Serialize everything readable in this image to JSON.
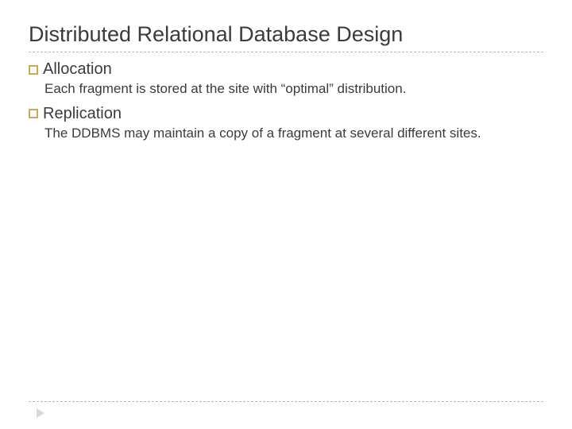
{
  "title": "Distributed Relational Database Design",
  "items": [
    {
      "heading": "Allocation",
      "body": "Each fragment is stored at the site with “optimal” distribution."
    },
    {
      "heading": "Replication",
      "body": "The DDBMS may maintain a copy of a fragment at several different sites."
    }
  ]
}
